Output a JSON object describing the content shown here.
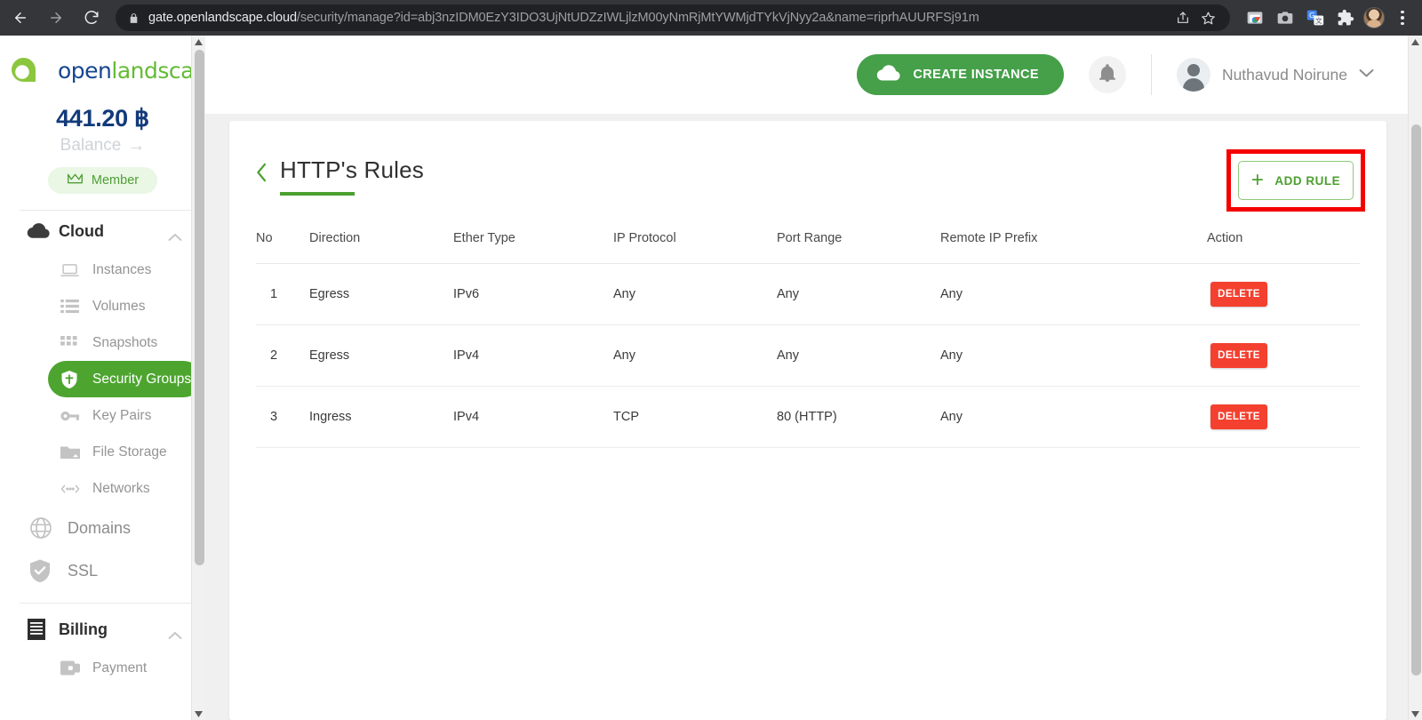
{
  "browser": {
    "back_icon": "back-arrow-icon",
    "forward_icon": "forward-arrow-icon",
    "reload_icon": "reload-icon",
    "lock_icon": "lock-icon",
    "url_host": "gate.openlandscape.cloud",
    "url_path": "/security/manage?id=abj3nzIDM0EzY3IDO3UjNtUDZzIWLjlzM00yNmRjMtYWMjdTYkVjNyy2a&name=riprhAUURFSj91m",
    "omnibox_icons": [
      "share-icon",
      "bookmark-star-icon"
    ],
    "toolbar_icons": [
      "chrome-media-icon",
      "camera-icon",
      "translate-icon",
      "extensions-puzzle-icon",
      "profile-avatar",
      "three-dot-menu-icon"
    ]
  },
  "sidebar": {
    "logo_text_1": "open",
    "logo_text_2": "landscape",
    "balance_amount": "441.20 ฿",
    "balance_label": "Balance",
    "balance_arrow": "→",
    "member_badge": "Member",
    "member_icon": "crown-icon",
    "groups": [
      {
        "label": "Cloud",
        "icon": "cloud-icon",
        "chevron": "chevron-up-icon",
        "items": [
          {
            "label": "Instances",
            "icon": "laptop-icon",
            "active": false
          },
          {
            "label": "Volumes",
            "icon": "list-storage-icon",
            "active": false
          },
          {
            "label": "Snapshots",
            "icon": "grid-icon",
            "active": false
          },
          {
            "label": "Security Groups",
            "icon": "shield-icon",
            "active": true
          },
          {
            "label": "Key Pairs",
            "icon": "key-icon",
            "active": false
          },
          {
            "label": "File Storage",
            "icon": "folder-icon",
            "active": false
          },
          {
            "label": "Networks",
            "icon": "network-icon",
            "active": false
          }
        ]
      }
    ],
    "flat_items": [
      {
        "label": "Domains",
        "icon": "globe-icon"
      },
      {
        "label": "SSL",
        "icon": "shield-check-icon"
      }
    ],
    "billing_group": {
      "label": "Billing",
      "icon": "receipt-icon",
      "chevron": "chevron-up-icon",
      "items": [
        {
          "label": "Payment",
          "icon": "wallet-icon"
        }
      ]
    }
  },
  "topbar": {
    "create_instance_label": "CREATE INSTANCE",
    "create_instance_icon": "cloud-icon",
    "notification_icon": "bell-icon",
    "user_name": "Nuthavud Noirune",
    "user_chevron": "chevron-down-icon",
    "user_avatar": "user-avatar"
  },
  "main": {
    "back_icon": "chevron-left-icon",
    "page_title": "HTTP's Rules",
    "add_rule_label": "ADD RULE",
    "add_rule_icon": "plus-icon",
    "highlight_color": "#f50000",
    "table": {
      "headers": [
        "No",
        "Direction",
        "Ether Type",
        "IP Protocol",
        "Port Range",
        "Remote IP Prefix",
        "Action"
      ],
      "rows": [
        {
          "no": "1",
          "direction": "Egress",
          "ether_type": "IPv6",
          "ip_protocol": "Any",
          "port_range": "Any",
          "remote_ip_prefix": "Any",
          "action": "DELETE"
        },
        {
          "no": "2",
          "direction": "Egress",
          "ether_type": "IPv4",
          "ip_protocol": "Any",
          "port_range": "Any",
          "remote_ip_prefix": "Any",
          "action": "DELETE"
        },
        {
          "no": "3",
          "direction": "Ingress",
          "ether_type": "IPv4",
          "ip_protocol": "TCP",
          "port_range": "80 (HTTP)",
          "remote_ip_prefix": "Any",
          "action": "DELETE"
        }
      ]
    }
  },
  "colors": {
    "brand_green": "#4da52f",
    "brand_blue": "#17468f",
    "delete_red": "#f4402f",
    "highlight_red": "#f50000"
  }
}
